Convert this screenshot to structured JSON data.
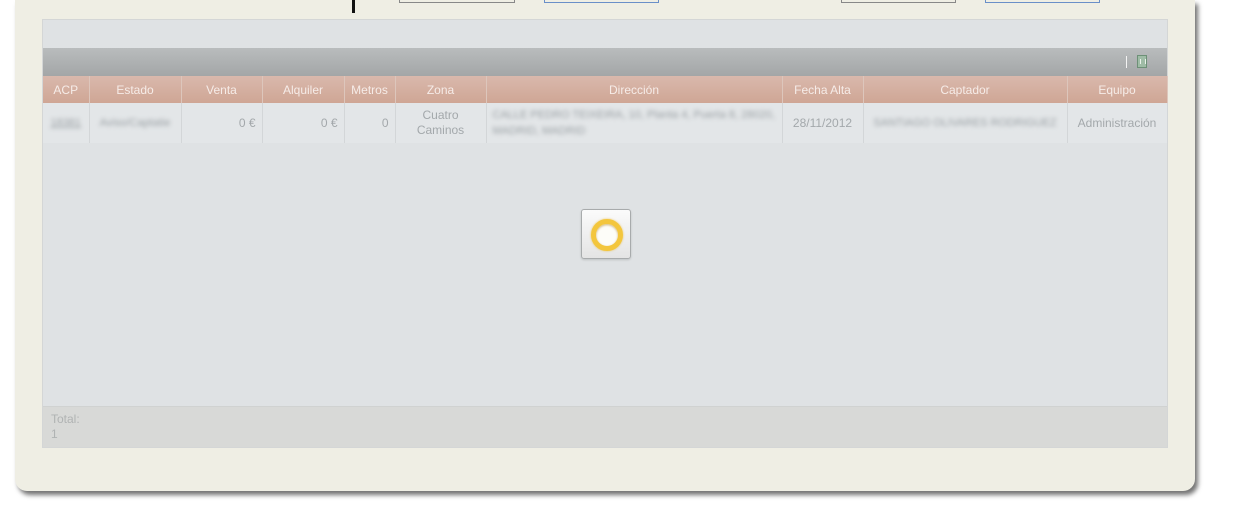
{
  "grid": {
    "columns": [
      "ACP",
      "Estado",
      "Venta",
      "Alquiler",
      "Metros",
      "Zona",
      "Dirección",
      "Fecha Alta",
      "Captador",
      "Equipo"
    ],
    "rows": [
      {
        "acp": "18381",
        "estado": "Aviso/Captatie",
        "venta": "0 €",
        "alquiler": "0 €",
        "metros": "0",
        "zona": "Cuatro Caminos",
        "direccion": "CALLE PEDRO TEIXEIRA, 10, Planta 4, Puerta 8, 28020, MADRID, MADRID",
        "fecha_alta": "28/11/2012",
        "captador": "SANTIAGO OLIVARES RODRIGUEZ",
        "equipo": "Administración"
      }
    ],
    "footer": {
      "total_label": "Total:",
      "total_value": "1"
    },
    "toolbar": {
      "separator": "|",
      "export_icon": "excel-export-icon"
    }
  },
  "loader": {
    "icon": "loading-spinner-icon",
    "ring_color": "#f3c63d"
  },
  "colors": {
    "panel_bg": "#efeee4",
    "header_bg": "#d3ab9b",
    "toolbar_bg": "#b0b3b4"
  }
}
